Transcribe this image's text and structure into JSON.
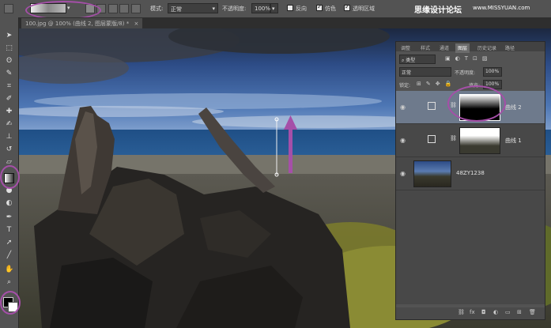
{
  "options_bar": {
    "mode_label": "模式:",
    "mode_value": "正常",
    "opacity_label": "不透明度:",
    "opacity_value": "100%",
    "reverse_label": "反向",
    "dither_label": "仿色",
    "transparency_label": "透明区域"
  },
  "watermark": {
    "site_name": "思缘设计论坛",
    "site_url": "www.MISSYUAN.com"
  },
  "document_tab": {
    "title": "100.jpg @ 100% (曲线 2, 图层蒙版/8) *",
    "close": "×"
  },
  "panel": {
    "tabs": [
      "调整",
      "样式",
      "通道",
      "图层",
      "历史记录",
      "路径"
    ],
    "active_tab": "图层",
    "kind_label": "类型",
    "blend_mode": "正常",
    "opacity_label": "不透明度:",
    "opacity_value": "100%",
    "lock_label": "锁定:",
    "fill_label": "填充:",
    "fill_value": "100%",
    "layers": [
      {
        "name": "曲线 2",
        "type": "adjustment",
        "selected": true
      },
      {
        "name": "曲线 1",
        "type": "adjustment",
        "selected": false
      },
      {
        "name": "48ZY1238",
        "type": "image",
        "selected": false
      }
    ],
    "bottom_icons": [
      "link-icon",
      "fx-icon",
      "mask-icon",
      "adjustment-icon",
      "folder-icon",
      "new-layer-icon",
      "trash-icon"
    ]
  },
  "tools": [
    "move-icon",
    "marquee-icon",
    "lasso-icon",
    "quick-select-icon",
    "crop-icon",
    "eyedropper-icon",
    "healing-icon",
    "brush-icon",
    "stamp-icon",
    "history-brush-icon",
    "eraser-icon",
    "gradient-icon",
    "blur-icon",
    "dodge-icon",
    "pen-icon",
    "type-icon",
    "path-select-icon",
    "shape-icon",
    "hand-icon",
    "zoom-icon"
  ],
  "colors": {
    "annotation": "#a54fa8",
    "foreground": "#000000",
    "background": "#ffffff",
    "selected_layer": "#6e7a8c"
  }
}
